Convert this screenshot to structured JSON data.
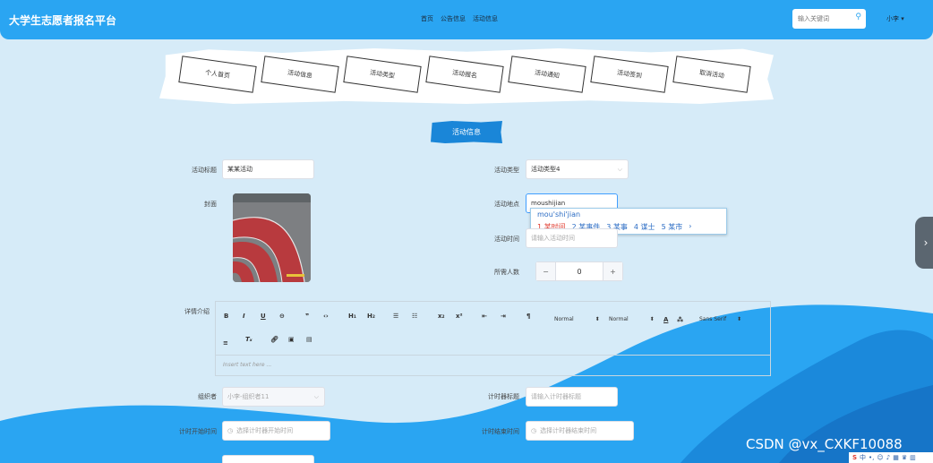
{
  "header": {
    "brand": "大学生志愿者报名平台",
    "nav": [
      "首页",
      "公告信息",
      "活动信息"
    ],
    "search_placeholder": "输入关键词",
    "user": "小李"
  },
  "tabs": [
    "个人首页",
    "活动信息",
    "活动类型",
    "活动报名",
    "活动通知",
    "活动签到",
    "取消活动"
  ],
  "section_button": "活动信息",
  "form": {
    "title_label": "活动标题",
    "title_value": "某某活动",
    "type_label": "活动类型",
    "type_value": "活动类型4",
    "cover_label": "封面",
    "address_label": "活动地点",
    "address_value": "moushijian",
    "time_label": "活动时间",
    "time_placeholder": "请输入活动时间",
    "people_label": "所需人数",
    "people_value": "0",
    "detail_label": "详情介绍",
    "organizer_label": "组织者",
    "organizer_placeholder": "小李-组织者11",
    "timer_title_label": "计时器标题",
    "timer_title_placeholder": "请输入计时器标题",
    "timer_start_label": "计时开始时间",
    "timer_start_placeholder": "选择计时器开始时间",
    "timer_end_label": "计时结束时间",
    "timer_end_placeholder": "选择计时器结束时间"
  },
  "ime": {
    "pinyin": "mou'shi'jian",
    "candidates": [
      "1 某时间",
      "2 某事件",
      "3 某事",
      "4 谋士",
      "5 某市"
    ],
    "next": "›"
  },
  "editor": {
    "placeholder": "Insert text here ...",
    "header_select": "Normal",
    "size_select": "Normal",
    "font_select": "Sans Serif"
  },
  "watermark": "CSDN @vx_CXKF10088",
  "tray": "中"
}
